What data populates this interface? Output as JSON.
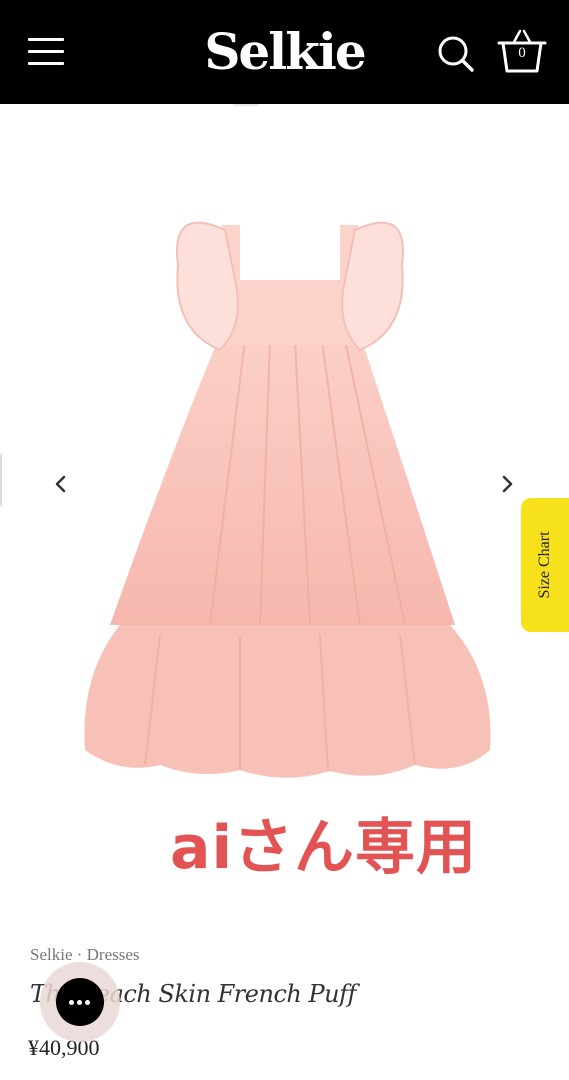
{
  "header": {
    "brand": "Selkie",
    "cart_count": "0",
    "icons": {
      "menu": "hamburger-menu-icon",
      "search": "search-icon",
      "cart": "basket-icon"
    }
  },
  "gallery": {
    "size_chart_label": "Size Chart",
    "overlay_text": "aiさん専用",
    "overlay_color": "#e25353",
    "icons": {
      "prev": "chevron-left-icon",
      "next": "chevron-right-icon"
    }
  },
  "product": {
    "breadcrumb": "Selkie · Dresses",
    "title": "The Peach Skin French Puff",
    "price": "¥40,900"
  },
  "chat": {
    "icon": "chat-bubble-icon"
  },
  "colors": {
    "header_bg": "#000000",
    "size_chart_bg": "#f6e11a",
    "dress": "#f8c3bb"
  }
}
